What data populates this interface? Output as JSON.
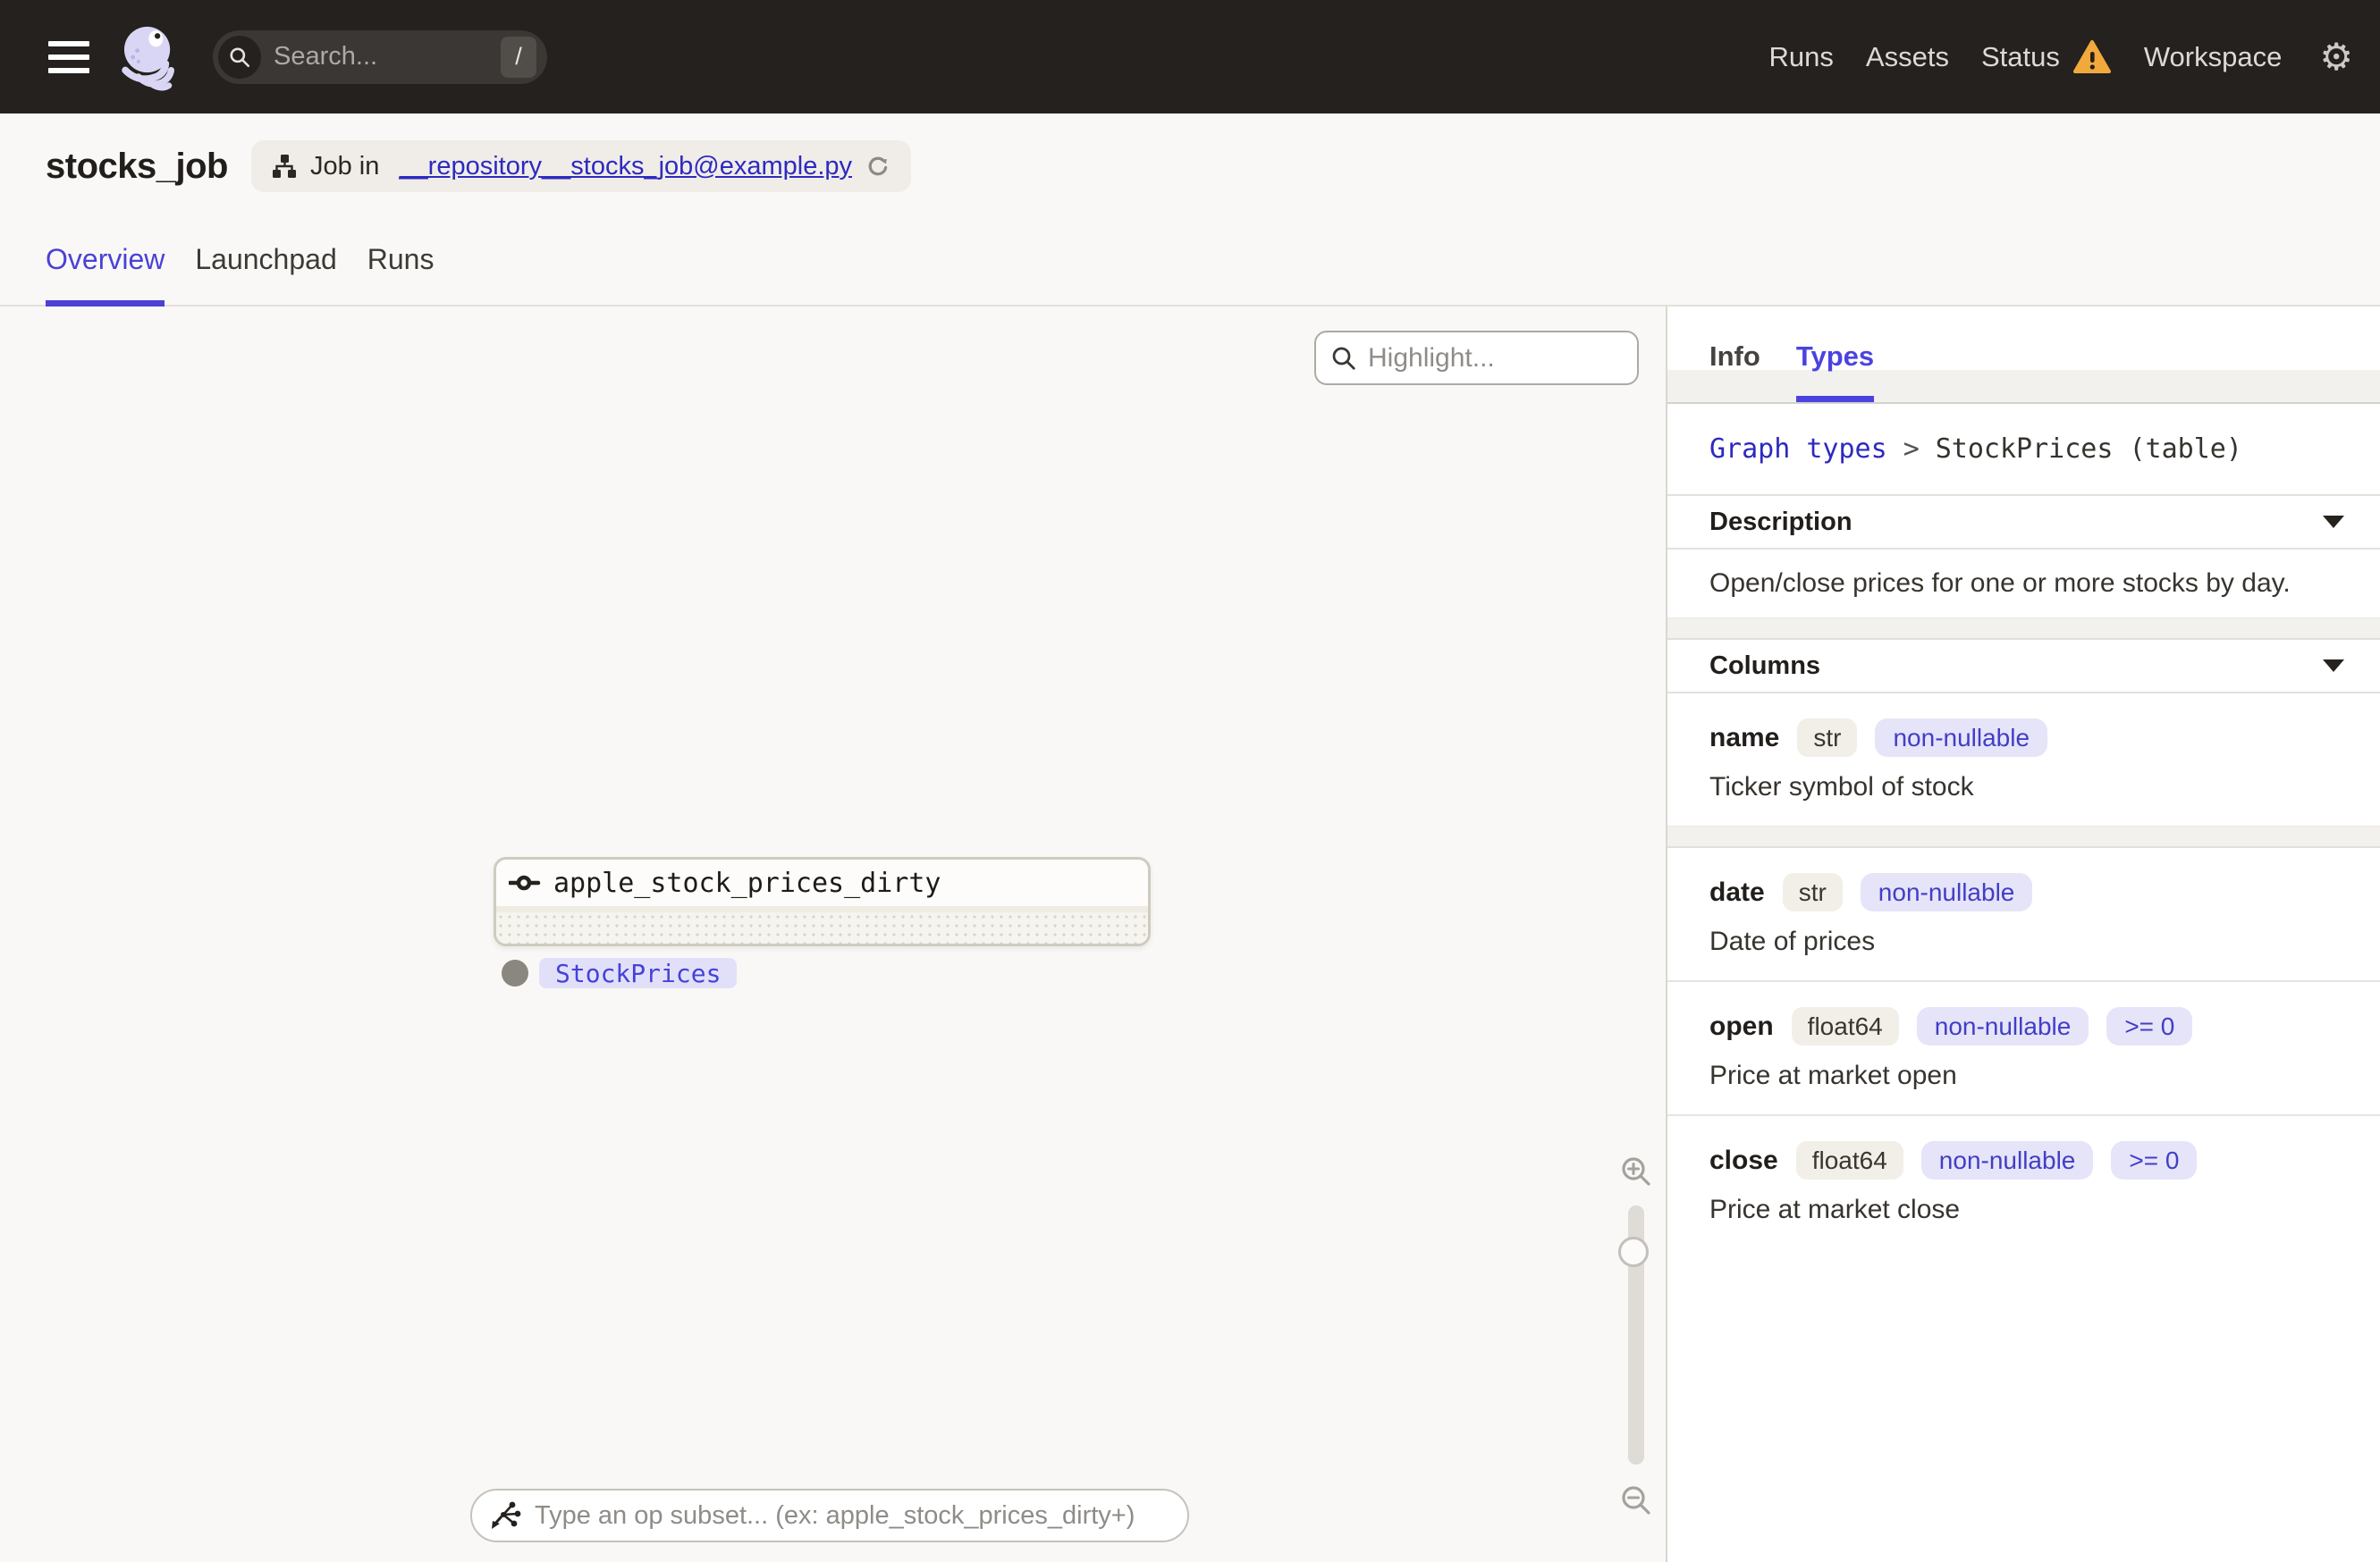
{
  "topbar": {
    "search": {
      "placeholder": "Search...",
      "shortcut": "/"
    },
    "nav": [
      {
        "label": "Runs",
        "warning": false
      },
      {
        "label": "Assets",
        "warning": false
      },
      {
        "label": "Status",
        "warning": true
      },
      {
        "label": "Workspace",
        "warning": false
      }
    ]
  },
  "header": {
    "title": "stocks_job",
    "job_badge": {
      "prefix": "Job in",
      "link": "__repository__stocks_job@example.py"
    },
    "tabs": [
      {
        "label": "Overview",
        "active": true
      },
      {
        "label": "Launchpad",
        "active": false
      },
      {
        "label": "Runs",
        "active": false
      }
    ]
  },
  "canvas": {
    "highlight_placeholder": "Highlight...",
    "node": {
      "name": "apple_stock_prices_dirty",
      "type_tag": "StockPrices"
    },
    "op_subset_placeholder": "Type an op subset... (ex: apple_stock_prices_dirty+)"
  },
  "panel": {
    "tabs": [
      {
        "label": "Info",
        "active": false
      },
      {
        "label": "Types",
        "active": true
      }
    ],
    "breadcrumb": {
      "link": "Graph types",
      "separator": ">",
      "current": "StockPrices (table)"
    },
    "description": {
      "title": "Description",
      "text": "Open/close prices for one or more stocks by day."
    },
    "columns_title": "Columns",
    "columns": [
      {
        "name": "name",
        "type": "str",
        "badges": [
          "non-nullable"
        ],
        "description": "Ticker symbol of stock",
        "separator": "band"
      },
      {
        "name": "date",
        "type": "str",
        "badges": [
          "non-nullable"
        ],
        "description": "Date of prices",
        "separator": "line"
      },
      {
        "name": "open",
        "type": "float64",
        "badges": [
          "non-nullable",
          ">= 0"
        ],
        "description": "Price at market open",
        "separator": "line"
      },
      {
        "name": "close",
        "type": "float64",
        "badges": [
          "non-nullable",
          ">= 0"
        ],
        "description": "Price at market close",
        "separator": "none"
      }
    ]
  },
  "colors": {
    "topbar_bg": "#24211E",
    "accent_indigo": "#4B41D6",
    "link_blue": "#2D2ABF",
    "warning_amber": "#F2A93C",
    "tag_bg": "#E2E0F9",
    "chip_indigo_bg": "#E6E4F9",
    "chip_tan_bg": "#F1EFE8",
    "canvas_bg": "#F9F8F6"
  }
}
